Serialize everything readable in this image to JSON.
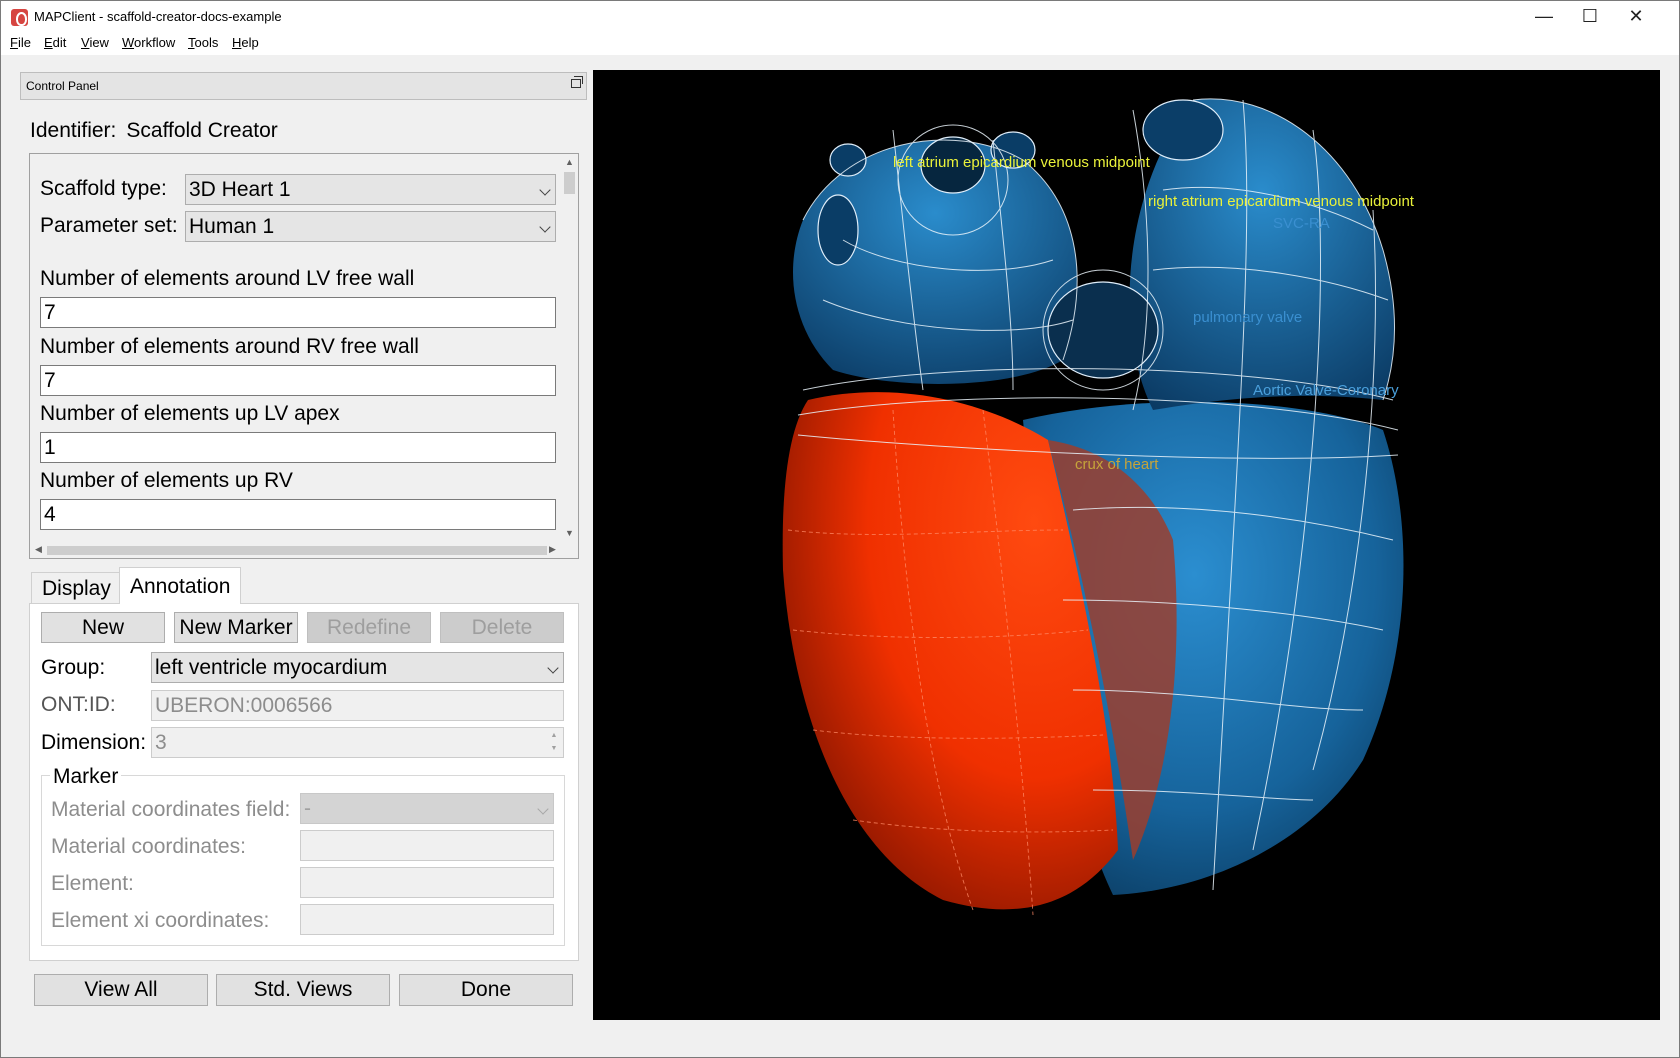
{
  "window": {
    "title": "MAPClient - scaffold-creator-docs-example",
    "minimize_icon": "minimize-icon",
    "maximize_icon": "maximize-icon",
    "close_icon": "close-icon"
  },
  "menu": [
    {
      "label": "File",
      "underline": "F",
      "rest": "ile"
    },
    {
      "label": "Edit",
      "underline": "E",
      "rest": "dit"
    },
    {
      "label": "View",
      "underline": "V",
      "rest": "iew"
    },
    {
      "label": "Workflow",
      "underline": "W",
      "rest": "orkflow"
    },
    {
      "label": "Tools",
      "underline": "T",
      "rest": "ools"
    },
    {
      "label": "Help",
      "underline": "H",
      "rest": "elp"
    }
  ],
  "control_panel": {
    "title": "Control Panel",
    "identifier_label": "Identifier:",
    "identifier_value": "Scaffold Creator"
  },
  "parameters": {
    "scaffold_type_label": "Scaffold type:",
    "scaffold_type_value": "3D Heart 1",
    "parameter_set_label": "Parameter set:",
    "parameter_set_value": "Human 1",
    "fields": [
      {
        "label": "Number of elements around LV free wall",
        "value": "7"
      },
      {
        "label": "Number of elements around RV free wall",
        "value": "7"
      },
      {
        "label": "Number of elements up LV apex",
        "value": "1"
      },
      {
        "label": "Number of elements up RV",
        "value": "4"
      }
    ]
  },
  "tabs": {
    "display": "Display",
    "annotation": "Annotation",
    "active": "Annotation"
  },
  "annotation": {
    "new_button": "New",
    "new_marker_button": "New Marker",
    "redefine_button": "Redefine",
    "delete_button": "Delete",
    "group_label": "Group:",
    "group_value": "left ventricle myocardium",
    "ontid_label": "ONT:ID:",
    "ontid_value": "UBERON:0006566",
    "dimension_label": "Dimension:",
    "dimension_value": "3",
    "marker": {
      "title": "Marker",
      "material_coordinates_field_label": "Material coordinates field:",
      "material_coordinates_field_value": "-",
      "material_coordinates_label": "Material coordinates:",
      "material_coordinates_value": "",
      "element_label": "Element:",
      "element_value": "",
      "element_xi_label": "Element xi coordinates:",
      "element_xi_value": ""
    }
  },
  "bottom_buttons": {
    "view_all": "View All",
    "std_views": "Std. Views",
    "done": "Done"
  },
  "viewer": {
    "background": "#000000",
    "lv_color": "#ff3a10",
    "rv_color": "#1a78b8",
    "label_color": "#eaf23a",
    "labels": [
      "left atrium epicardium venous midpoint",
      "right atrium epicardium venous midpoint",
      "SVC-RA",
      "pulmonary valve",
      "Aortic Valve-Coronary",
      "crux of heart"
    ]
  }
}
